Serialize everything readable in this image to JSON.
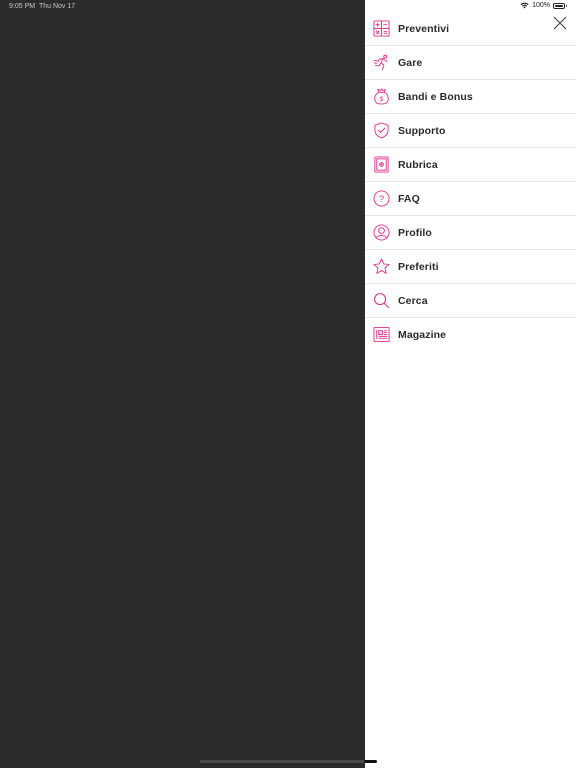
{
  "status_bar": {
    "time": "9:05 PM",
    "date": "Thu Nov 17",
    "battery": "100%"
  },
  "colors": {
    "accent": "#e0318a",
    "overlay": "#2b2b2b",
    "drawer": "#ffffff"
  },
  "menu": {
    "items": [
      {
        "label": "Preventivi",
        "icon": "calculator-icon"
      },
      {
        "label": "Gare",
        "icon": "runner-icon"
      },
      {
        "label": "Bandi e Bonus",
        "icon": "money-bag-icon"
      },
      {
        "label": "Supporto",
        "icon": "shield-check-icon"
      },
      {
        "label": "Rubrica",
        "icon": "address-book-icon"
      },
      {
        "label": "FAQ",
        "icon": "question-icon"
      },
      {
        "label": "Profilo",
        "icon": "user-icon"
      },
      {
        "label": "Preferiti",
        "icon": "star-icon"
      },
      {
        "label": "Cerca",
        "icon": "search-icon"
      },
      {
        "label": "Magazine",
        "icon": "newspaper-icon"
      }
    ]
  }
}
